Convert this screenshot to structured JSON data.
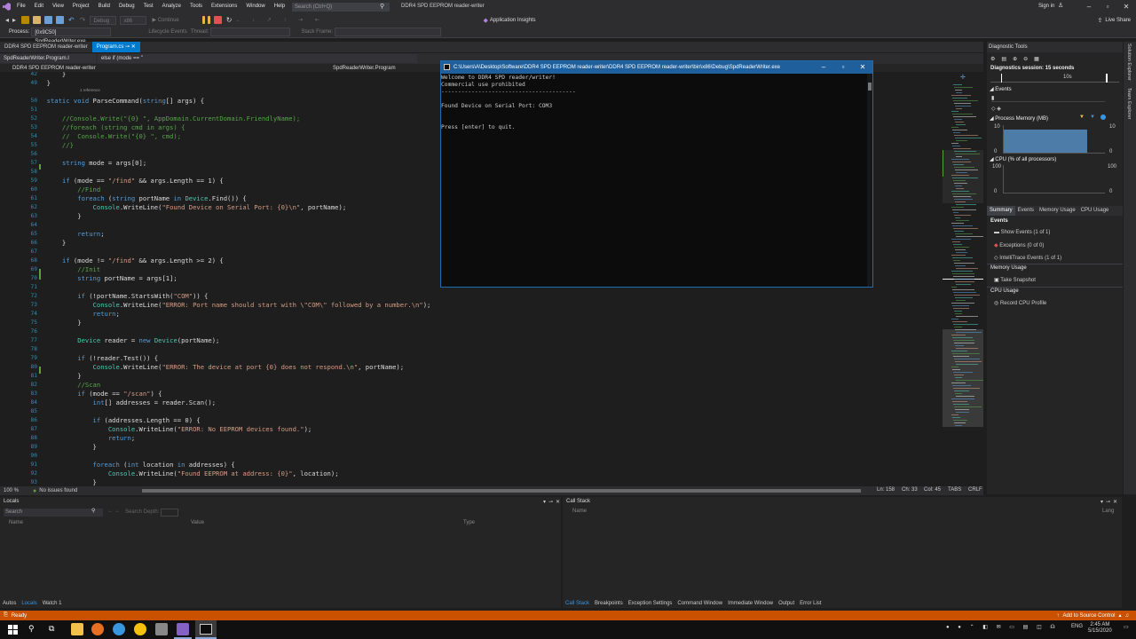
{
  "menu": [
    "File",
    "Edit",
    "View",
    "Project",
    "Build",
    "Debug",
    "Test",
    "Analyze",
    "Tools",
    "Extensions",
    "Window",
    "Help"
  ],
  "search": {
    "placeholder": "Search (Ctrl+Q)"
  },
  "window_title": "DDR4 SPD EEPROM reader-writer",
  "sign_in": "Sign in",
  "toolbar": {
    "config": "Debug",
    "platform": "x86",
    "continue_label": "Continue",
    "app_insights": "Application Insights",
    "live_share": "Live Share"
  },
  "toolbar2": {
    "process_label": "Process:",
    "process_value": "[0x9C50] SpdReaderWriter.exe",
    "lifecycle": "Lifecycle Events",
    "thread": "Thread:",
    "stack_frame": "Stack Frame:"
  },
  "doc_tabs": [
    "DDR4 SPD EEPROM reader-writer",
    "Program.cs"
  ],
  "nav": {
    "class_sel": "SpdReaderWriter.Program.I",
    "member_sel": "else if (mode == \"",
    "file_label": "DDR4 SPD EEPROM reader-writer",
    "class_label": "SpdReaderWriter.Program"
  },
  "editor": {
    "refs": "1 reference",
    "lines": [
      {
        "n": "42",
        "code": "            }"
      },
      {
        "n": "49",
        "code": "        }"
      },
      {
        "n": "50",
        "code": "        static void ParseCommand(string[] args) {"
      },
      {
        "n": "51",
        "code": ""
      },
      {
        "n": "52",
        "code": "            //Console.Write(\"{0} \", AppDomain.CurrentDomain.FriendlyName);"
      },
      {
        "n": "53",
        "code": "            //foreach (string cmd in args) {"
      },
      {
        "n": "54",
        "code": "            //  Console.Write(\"{0} \", cmd);"
      },
      {
        "n": "55",
        "code": "            //}"
      },
      {
        "n": "56",
        "code": ""
      },
      {
        "n": "57",
        "code": "            string mode = args[0];"
      },
      {
        "n": "58",
        "code": ""
      },
      {
        "n": "59",
        "code": "            if (mode == \"/find\" && args.Length == 1) {"
      },
      {
        "n": "60",
        "code": "                //Find"
      },
      {
        "n": "61",
        "code": "                foreach (string portName in Device.Find()) {"
      },
      {
        "n": "62",
        "code": "                    Console.WriteLine(\"Found Device on Serial Port: {0}\\n\", portName);"
      },
      {
        "n": "63",
        "code": "                }"
      },
      {
        "n": "64",
        "code": ""
      },
      {
        "n": "65",
        "code": "                return;"
      },
      {
        "n": "66",
        "code": "            }"
      },
      {
        "n": "67",
        "code": ""
      },
      {
        "n": "68",
        "code": "            if (mode != \"/find\" && args.Length >= 2) {"
      },
      {
        "n": "69",
        "code": "                //Init"
      },
      {
        "n": "70",
        "code": "                string portName = args[1];"
      },
      {
        "n": "71",
        "code": ""
      },
      {
        "n": "72",
        "code": "                if (!portName.StartsWith(\"COM\")) {"
      },
      {
        "n": "73",
        "code": "                    Console.WriteLine(\"ERROR: Port name should start with \\\"COM\\\" followed by a number.\\n\");"
      },
      {
        "n": "74",
        "code": "                    return;"
      },
      {
        "n": "75",
        "code": "                }"
      },
      {
        "n": "76",
        "code": ""
      },
      {
        "n": "77",
        "code": "                Device reader = new Device(portName);"
      },
      {
        "n": "78",
        "code": ""
      },
      {
        "n": "79",
        "code": "                if (!reader.Test()) {"
      },
      {
        "n": "80",
        "code": "                    Console.WriteLine(\"ERROR: The device at port {0} does not respond.\\n\", portName);"
      },
      {
        "n": "81",
        "code": "                }"
      },
      {
        "n": "82",
        "code": "                //Scan"
      },
      {
        "n": "83",
        "code": "                if (mode == \"/scan\") {"
      },
      {
        "n": "84",
        "code": "                    int[] addresses = reader.Scan();"
      },
      {
        "n": "85",
        "code": ""
      },
      {
        "n": "86",
        "code": "                    if (addresses.Length == 0) {"
      },
      {
        "n": "87",
        "code": "                        Console.WriteLine(\"ERROR: No EEPROM devices found.\");"
      },
      {
        "n": "88",
        "code": "                        return;"
      },
      {
        "n": "89",
        "code": "                    }"
      },
      {
        "n": "90",
        "code": ""
      },
      {
        "n": "91",
        "code": "                    foreach (int location in addresses) {"
      },
      {
        "n": "92",
        "code": "                        Console.WriteLine(\"Found EEPROM at address: {0}\", location);"
      },
      {
        "n": "93",
        "code": "                    }"
      }
    ]
  },
  "editor_status": {
    "zoom": "100 %",
    "issues": "No issues found",
    "ln": "Ln: 158",
    "ch": "Ch: 33",
    "col": "Col: 45",
    "tabs": "TABS",
    "crlf": "CRLF"
  },
  "console": {
    "title": "C:\\Users\\A\\Desktop\\Software\\DDR4 SPD EEPROM reader-writer\\DDR4 SPD EEPROM reader-writer\\bin\\x86\\Debug\\SpdReaderWriter.exe",
    "lines": [
      "Welcome to DDR4 SPD reader/writer!",
      "Commercial use prohibited",
      "----------------------------------------",
      "",
      "Found Device on Serial Port: COM3",
      "",
      "",
      "Press [enter] to quit."
    ]
  },
  "diagnostics": {
    "title": "Diagnostic Tools",
    "session": "Diagnostics session: 15 seconds",
    "timeline_label": "10s",
    "events_label": "Events",
    "memory_label": "Process Memory (MB)",
    "mem_top": "10",
    "mem_bottom": "0",
    "memory_level": 0.8,
    "cpu_label": "CPU (% of all processors)",
    "cpu_top": "100",
    "cpu_bottom": "0",
    "tabs": [
      "Summary",
      "Events",
      "Memory Usage",
      "CPU Usage"
    ],
    "events_heading": "Events",
    "show_events": "Show Events (1 of 1)",
    "exceptions": "Exceptions (0 of 0)",
    "intellitrace": "IntelliTrace Events (1 of 1)",
    "memory_heading": "Memory Usage",
    "take_snapshot": "Take Snapshot",
    "cpu_heading": "CPU Usage",
    "record_cpu": "Record CPU Profile"
  },
  "right_rail": [
    "Solution Explorer",
    "Team Explorer"
  ],
  "locals": {
    "title": "Locals",
    "search_placeholder": "Search",
    "search_depth": "Search Depth:",
    "cols": [
      "Name",
      "Value",
      "Type"
    ],
    "tabs": [
      "Autos",
      "Locals",
      "Watch 1"
    ]
  },
  "callstack": {
    "title": "Call Stack",
    "cols": [
      "Name",
      "Lang"
    ],
    "tabs": [
      "Call Stack",
      "Breakpoints",
      "Exception Settings",
      "Command Window",
      "Immediate Window",
      "Output",
      "Error List"
    ]
  },
  "status": {
    "ready": "Ready",
    "source_control": "Add to Source Control"
  },
  "taskbar": {
    "lang": "ENG",
    "time": "2:45 AM",
    "date": "5/15/2020"
  },
  "colors": {
    "accent": "#007acc",
    "status_debug": "#ca5100",
    "console_title": "#1f5f9c"
  }
}
